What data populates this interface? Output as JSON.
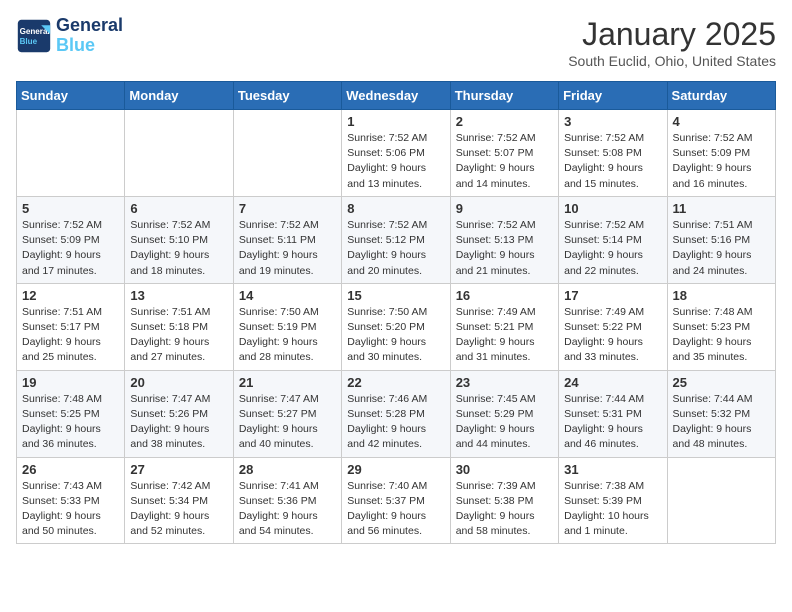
{
  "header": {
    "logo_line1": "General",
    "logo_line2": "Blue",
    "month": "January 2025",
    "location": "South Euclid, Ohio, United States"
  },
  "weekdays": [
    "Sunday",
    "Monday",
    "Tuesday",
    "Wednesday",
    "Thursday",
    "Friday",
    "Saturday"
  ],
  "weeks": [
    [
      {
        "day": "",
        "info": ""
      },
      {
        "day": "",
        "info": ""
      },
      {
        "day": "",
        "info": ""
      },
      {
        "day": "1",
        "info": "Sunrise: 7:52 AM\nSunset: 5:06 PM\nDaylight: 9 hours and 13 minutes."
      },
      {
        "day": "2",
        "info": "Sunrise: 7:52 AM\nSunset: 5:07 PM\nDaylight: 9 hours and 14 minutes."
      },
      {
        "day": "3",
        "info": "Sunrise: 7:52 AM\nSunset: 5:08 PM\nDaylight: 9 hours and 15 minutes."
      },
      {
        "day": "4",
        "info": "Sunrise: 7:52 AM\nSunset: 5:09 PM\nDaylight: 9 hours and 16 minutes."
      }
    ],
    [
      {
        "day": "5",
        "info": "Sunrise: 7:52 AM\nSunset: 5:09 PM\nDaylight: 9 hours and 17 minutes."
      },
      {
        "day": "6",
        "info": "Sunrise: 7:52 AM\nSunset: 5:10 PM\nDaylight: 9 hours and 18 minutes."
      },
      {
        "day": "7",
        "info": "Sunrise: 7:52 AM\nSunset: 5:11 PM\nDaylight: 9 hours and 19 minutes."
      },
      {
        "day": "8",
        "info": "Sunrise: 7:52 AM\nSunset: 5:12 PM\nDaylight: 9 hours and 20 minutes."
      },
      {
        "day": "9",
        "info": "Sunrise: 7:52 AM\nSunset: 5:13 PM\nDaylight: 9 hours and 21 minutes."
      },
      {
        "day": "10",
        "info": "Sunrise: 7:52 AM\nSunset: 5:14 PM\nDaylight: 9 hours and 22 minutes."
      },
      {
        "day": "11",
        "info": "Sunrise: 7:51 AM\nSunset: 5:16 PM\nDaylight: 9 hours and 24 minutes."
      }
    ],
    [
      {
        "day": "12",
        "info": "Sunrise: 7:51 AM\nSunset: 5:17 PM\nDaylight: 9 hours and 25 minutes."
      },
      {
        "day": "13",
        "info": "Sunrise: 7:51 AM\nSunset: 5:18 PM\nDaylight: 9 hours and 27 minutes."
      },
      {
        "day": "14",
        "info": "Sunrise: 7:50 AM\nSunset: 5:19 PM\nDaylight: 9 hours and 28 minutes."
      },
      {
        "day": "15",
        "info": "Sunrise: 7:50 AM\nSunset: 5:20 PM\nDaylight: 9 hours and 30 minutes."
      },
      {
        "day": "16",
        "info": "Sunrise: 7:49 AM\nSunset: 5:21 PM\nDaylight: 9 hours and 31 minutes."
      },
      {
        "day": "17",
        "info": "Sunrise: 7:49 AM\nSunset: 5:22 PM\nDaylight: 9 hours and 33 minutes."
      },
      {
        "day": "18",
        "info": "Sunrise: 7:48 AM\nSunset: 5:23 PM\nDaylight: 9 hours and 35 minutes."
      }
    ],
    [
      {
        "day": "19",
        "info": "Sunrise: 7:48 AM\nSunset: 5:25 PM\nDaylight: 9 hours and 36 minutes."
      },
      {
        "day": "20",
        "info": "Sunrise: 7:47 AM\nSunset: 5:26 PM\nDaylight: 9 hours and 38 minutes."
      },
      {
        "day": "21",
        "info": "Sunrise: 7:47 AM\nSunset: 5:27 PM\nDaylight: 9 hours and 40 minutes."
      },
      {
        "day": "22",
        "info": "Sunrise: 7:46 AM\nSunset: 5:28 PM\nDaylight: 9 hours and 42 minutes."
      },
      {
        "day": "23",
        "info": "Sunrise: 7:45 AM\nSunset: 5:29 PM\nDaylight: 9 hours and 44 minutes."
      },
      {
        "day": "24",
        "info": "Sunrise: 7:44 AM\nSunset: 5:31 PM\nDaylight: 9 hours and 46 minutes."
      },
      {
        "day": "25",
        "info": "Sunrise: 7:44 AM\nSunset: 5:32 PM\nDaylight: 9 hours and 48 minutes."
      }
    ],
    [
      {
        "day": "26",
        "info": "Sunrise: 7:43 AM\nSunset: 5:33 PM\nDaylight: 9 hours and 50 minutes."
      },
      {
        "day": "27",
        "info": "Sunrise: 7:42 AM\nSunset: 5:34 PM\nDaylight: 9 hours and 52 minutes."
      },
      {
        "day": "28",
        "info": "Sunrise: 7:41 AM\nSunset: 5:36 PM\nDaylight: 9 hours and 54 minutes."
      },
      {
        "day": "29",
        "info": "Sunrise: 7:40 AM\nSunset: 5:37 PM\nDaylight: 9 hours and 56 minutes."
      },
      {
        "day": "30",
        "info": "Sunrise: 7:39 AM\nSunset: 5:38 PM\nDaylight: 9 hours and 58 minutes."
      },
      {
        "day": "31",
        "info": "Sunrise: 7:38 AM\nSunset: 5:39 PM\nDaylight: 10 hours and 1 minute."
      },
      {
        "day": "",
        "info": ""
      }
    ]
  ]
}
